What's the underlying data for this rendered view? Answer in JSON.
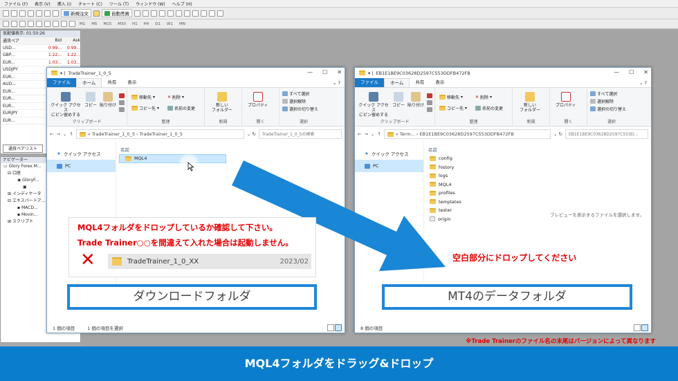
{
  "mt4": {
    "menu": [
      "ファイル (F)",
      "表示 (V)",
      "挿入 (I)",
      "チャート (C)",
      "ツール (T)",
      "ウィンドウ (W)",
      "ヘルプ (H)"
    ],
    "toolbar": {
      "new_order": "新規注文",
      "auto_trade": "自動売買"
    },
    "timeframes": [
      "M1",
      "M5",
      "M15",
      "M30",
      "H1",
      "H4",
      "D1",
      "W1",
      "MN"
    ],
    "market_watch": {
      "title": "気配値表示: 01:50:26",
      "headers": [
        "通貨ペア",
        "Bid",
        "Ask"
      ],
      "rows": [
        [
          "USD...",
          "0.99...",
          "0.99..."
        ],
        [
          "GBP...",
          "1.22...",
          "1.22..."
        ],
        [
          "EUR...",
          "1.03...",
          "1.03..."
        ],
        [
          "USDJPY",
          "129...",
          "129..."
        ],
        [
          "EUR...",
          "1.12...",
          "1.12..."
        ],
        [
          "AUD...",
          "0.68...",
          "0.68..."
        ],
        [
          "EUR...",
          "0.85...",
          "0.85..."
        ],
        [
          "EUR...",
          "1.51...",
          "1.51..."
        ],
        [
          "EUR...",
          "0.94...",
          "0.94..."
        ],
        [
          "EURJPY",
          "136...",
          "136..."
        ],
        [
          "EUR...",
          "1.35...",
          "1.35..."
        ]
      ],
      "tab": "通貨ペアリスト"
    },
    "navigator": {
      "title": "ナビゲーター",
      "items": [
        "Glory Forex M...",
        "口座",
        "GloryF...",
        "",
        "インディケータ",
        "エキスパートア...",
        "MACD...",
        "Movin...",
        "スクリプト"
      ]
    }
  },
  "left_window": {
    "title": "TradeTrainer_1_0_5",
    "tabs": [
      "ファイル",
      "ホーム",
      "共有",
      "表示"
    ],
    "ribbon": {
      "clipboard": {
        "pin": "クイック アクセス\nにピン留めする",
        "copy": "コピー",
        "paste": "貼り付け",
        "label": "クリップボード"
      },
      "organize": {
        "move": "移動先",
        "copy_to": "コピー先",
        "delete": "削除",
        "rename": "名前の変更",
        "label": "整理"
      },
      "new": {
        "folder": "新しい\nフォルダー",
        "label": "新規"
      },
      "open": {
        "props": "プロパティ",
        "label": "開く"
      },
      "select": {
        "all": "すべて選択",
        "none": "選択解除",
        "invert": "選択の切り替え",
        "label": "選択"
      }
    },
    "address": "« TradeTrainer_1_0_5 › TradeTrainer_1_0_5",
    "search": "TradeTrainer_1_0_5の検索",
    "nav": [
      "クイック アクセス",
      "PC"
    ],
    "column": "名前",
    "files": [
      "MQL4"
    ],
    "status": [
      "1 個の項目",
      "1 個の項目を選択"
    ]
  },
  "right_window": {
    "title": "EB1E1BE9C03628D2597C553DDFB472FB",
    "tabs": [
      "ファイル",
      "ホーム",
      "共有",
      "表示"
    ],
    "ribbon": {
      "clipboard": {
        "pin": "クイック アクセス\nにピン留めする",
        "copy": "コピー",
        "paste": "貼り付け",
        "label": "クリップボード"
      },
      "organize": {
        "move": "移動先",
        "copy_to": "コピー先",
        "delete": "削除",
        "rename": "名前の変更",
        "label": "整理"
      },
      "new": {
        "folder": "新しい\nフォルダー",
        "label": "新規"
      },
      "open": {
        "props": "プロパティ",
        "label": "開く"
      },
      "select": {
        "all": "すべて選択",
        "none": "選択解除",
        "invert": "選択の切り替え",
        "label": "選択"
      }
    },
    "address": "« Term... › EB1E1BE9C03628D2597C553DDFB472FB",
    "search": "EB1E1BE9C03628D2597C553D...",
    "nav": [
      "クイック アクセス",
      "PC"
    ],
    "column": "名前",
    "files": [
      "config",
      "history",
      "logs",
      "MQL4",
      "profiles",
      "templates",
      "tester",
      "origin"
    ],
    "preview": "プレビューを表示するファイルを選択します。",
    "status": [
      "8 個の項目"
    ]
  },
  "overlay": {
    "note_line1": "MQL4フォルダをドロップしているか確認して下さい。",
    "note_line2": "Trade Trainer○○を間違えて入れた場合は起動しません。",
    "x_mark": "✕",
    "example_name": "TradeTrainer_1_0_XX",
    "example_date": "2023/02",
    "label_left": "ダウンロードフォルダ",
    "label_right": "MT4のデータフォルダ",
    "drop_text": "空白部分にドロップしてください",
    "bottom_note": "※Trade Trainerのファイル名の末尾はバージョンによって異なります",
    "banner": "MQL4フォルダをドラッグ&ドロップ"
  },
  "colors": {
    "accent": "#0a7dcc",
    "arrow": "#1a86d6",
    "warning": "#e30000",
    "file_tab": "#1979ca"
  }
}
